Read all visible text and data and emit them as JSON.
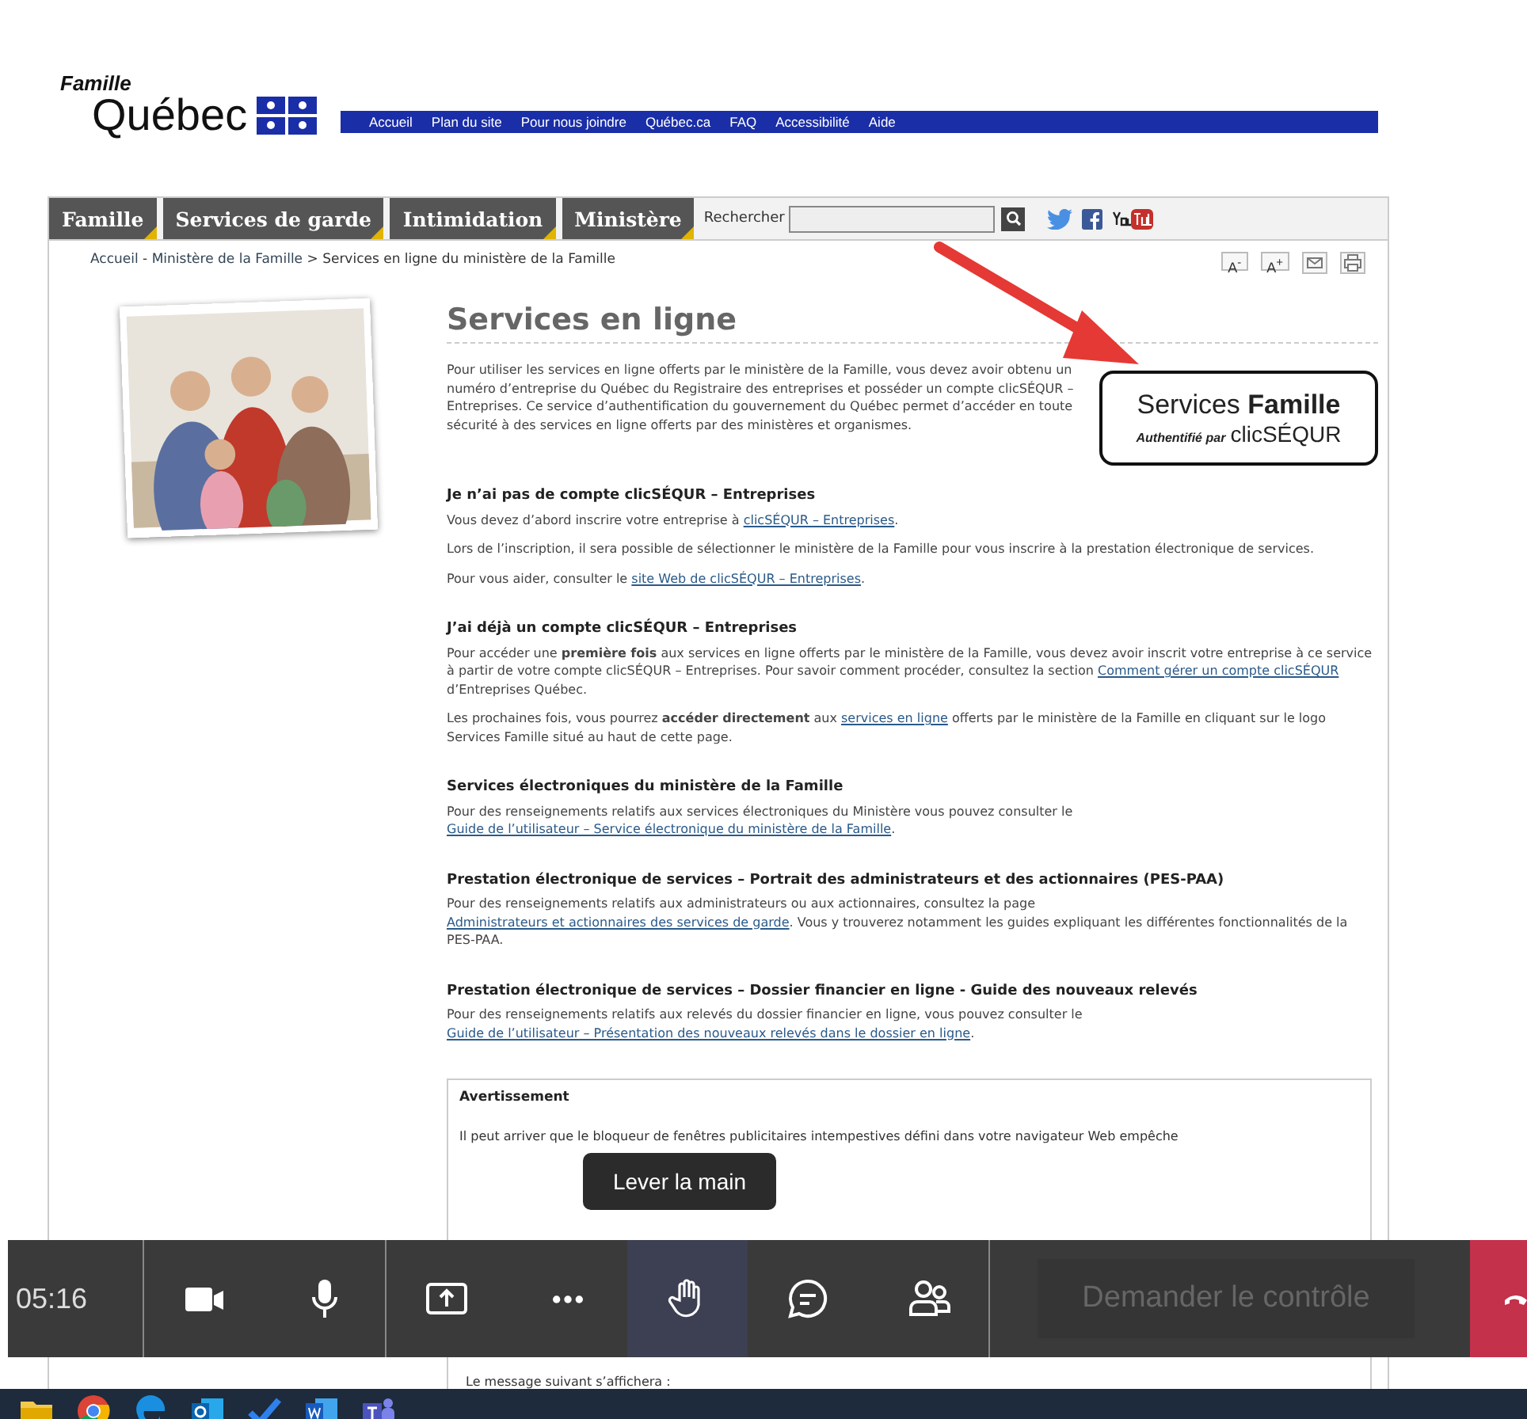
{
  "header": {
    "brand_small": "Famille",
    "brand": "Québec",
    "links": [
      "Accueil",
      "Plan du site",
      "Pour nous joindre",
      "Québec.ca",
      "FAQ",
      "Accessibilité",
      "Aide"
    ]
  },
  "nav": {
    "tabs": [
      {
        "label": "Famille"
      },
      {
        "label": "Services de garde"
      },
      {
        "label": "Intimidation"
      },
      {
        "label": "Ministère"
      }
    ],
    "search_label": "Rechercher"
  },
  "breadcrumb": {
    "links": [
      "Accueil",
      "Ministère de la Famille"
    ],
    "separators": [
      "-",
      ">"
    ],
    "current": "Services en ligne du ministère de la Famille"
  },
  "tools": [
    "A$^{-}$",
    "A$^{+}$"
  ],
  "page": {
    "title": "Services en ligne",
    "intro": "Pour utiliser les services en ligne offerts par le ministère de la Famille, vous devez avoir obtenu un numéro d’entreprise du Québec du Registraire des entreprises et posséder un compte clicSÉQUR – Entreprises. Ce service d’authentification du gouvernement du Québec permet d’accéder en toute sécurité à des services en ligne offerts par des ministères et organismes.",
    "logo": {
      "word": "Services",
      "bold_word": "Famille",
      "tagline": "Authentifié par",
      "brand": "clicSÉQUR"
    },
    "sections": [
      {
        "heading": "Je n’ai pas de compte clicSÉQUR – Entreprises",
        "paragraphs": [
          [
            {
              "kind": "text",
              "text": "Vous devez d’abord inscrire votre entreprise à "
            },
            {
              "kind": "link",
              "text": "clicSÉQUR – Entreprises"
            },
            {
              "kind": "text",
              "text": "."
            }
          ],
          [
            {
              "kind": "text",
              "text": "Lors de l’inscription, il sera possible de sélectionner le ministère de la Famille pour vous inscrire à la prestation électronique de services."
            }
          ],
          [
            {
              "kind": "text",
              "text": "Pour vous aider, consulter le "
            },
            {
              "kind": "link",
              "text": "site Web de clicSÉQUR – Entreprises"
            },
            {
              "kind": "text",
              "text": "."
            }
          ]
        ]
      },
      {
        "heading": "J’ai déjà un compte clicSÉQUR – Entreprises",
        "paragraphs": [
          [
            {
              "kind": "text",
              "text": "Pour accéder une "
            },
            {
              "kind": "bold",
              "text": "première fois"
            },
            {
              "kind": "text",
              "text": " aux services en ligne offerts par le ministère de la Famille, vous devez avoir inscrit votre entreprise à ce service à partir de votre compte clicSÉQUR – Entreprises. Pour savoir comment procéder, consultez la section "
            },
            {
              "kind": "link",
              "text": "Comment gérer un compte clicSÉQUR"
            },
            {
              "kind": "text",
              "text": " d’Entreprises Québec."
            }
          ],
          [
            {
              "kind": "text",
              "text": "Les prochaines fois, vous pourrez "
            },
            {
              "kind": "bold",
              "text": "accéder directement"
            },
            {
              "kind": "text",
              "text": " aux "
            },
            {
              "kind": "link",
              "text": "services en ligne"
            },
            {
              "kind": "text",
              "text": " offerts par le ministère de la Famille en cliquant sur le logo Services Famille situé au haut de cette page."
            }
          ]
        ]
      },
      {
        "heading": "Services électroniques du ministère de la Famille",
        "paragraphs": [
          [
            {
              "kind": "text",
              "text": "Pour des renseignements relatifs aux services électroniques du Ministère vous pouvez consulter le "
            },
            {
              "kind": "link",
              "text": "Guide de l’utilisateur – Service électronique du ministère de la Famille"
            },
            {
              "kind": "text",
              "text": "."
            }
          ]
        ]
      },
      {
        "heading": "Prestation électronique de services – Portrait des administrateurs et des actionnaires (PES-PAA)",
        "paragraphs": [
          [
            {
              "kind": "text",
              "text": "Pour des renseignements relatifs aux administrateurs ou aux actionnaires, consultez la page "
            },
            {
              "kind": "link",
              "text": "Administrateurs et actionnaires des services de garde"
            },
            {
              "kind": "text",
              "text": ". Vous y trouverez notamment les guides expliquant les différentes fonctionnalités de la PES-PAA."
            }
          ]
        ]
      },
      {
        "heading": "Prestation électronique de services – Dossier financier en ligne - Guide des nouveaux relevés",
        "paragraphs": [
          [
            {
              "kind": "text",
              "text": "Pour des renseignements relatifs aux relevés du dossier financier en ligne, vous pouvez consulter le "
            },
            {
              "kind": "link",
              "text": "Guide de l’utilisateur – Présentation des nouveaux relevés dans le dossier en ligne"
            },
            {
              "kind": "text",
              "text": "."
            }
          ]
        ]
      }
    ],
    "warning": {
      "title": "Avertissement",
      "line": "Il peut arriver que le bloqueur de fenêtres publicitaires intempestives défini dans votre navigateur Web empêche",
      "bullets": [
        "Le message suivant s’affichera :"
      ]
    }
  },
  "meeting_toolbar": {
    "time": "05:16",
    "tooltip": "Lever la main",
    "button_groups": [
      [
        {
          "kind": "camera",
          "selected": false
        },
        {
          "kind": "mic",
          "selected": false
        }
      ],
      [
        {
          "kind": "share",
          "selected": false
        },
        {
          "kind": "more",
          "selected": false
        },
        {
          "kind": "hand",
          "selected": true
        },
        {
          "kind": "chat",
          "selected": false
        },
        {
          "kind": "people",
          "selected": false
        }
      ]
    ],
    "control_button": {
      "label": "Demander le contrôle",
      "disabled": true
    }
  },
  "taskbar": {
    "apps": [
      {
        "kind": "folder"
      },
      {
        "kind": "chrome"
      },
      {
        "kind": "edge"
      },
      {
        "kind": "outlook"
      },
      {
        "kind": "todo"
      },
      {
        "kind": "word"
      },
      {
        "kind": "teams"
      }
    ]
  }
}
